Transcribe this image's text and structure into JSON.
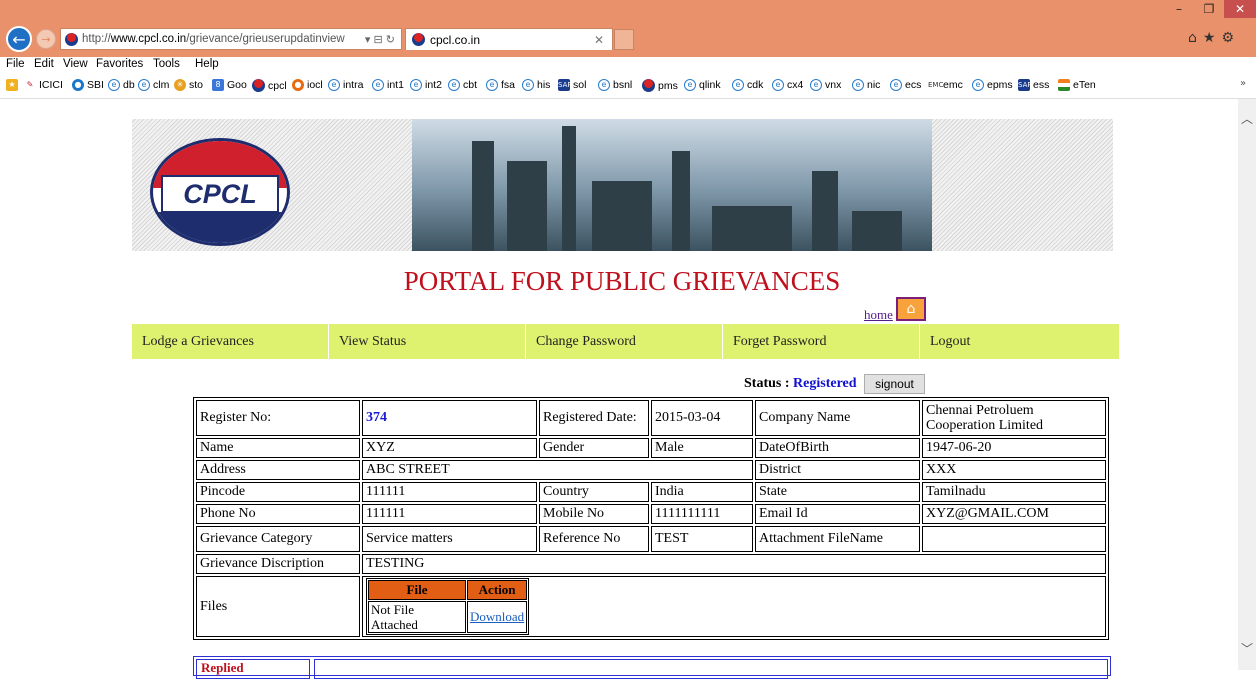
{
  "browser": {
    "url_prefix": "http://",
    "url_domain": "www.cpcl.co.in",
    "url_path": "/grievance/grieuserupdatinview",
    "tab_title": "cpcl.co.in",
    "menu": [
      "File",
      "Edit",
      "View",
      "Favorites",
      "Tools",
      "Help"
    ],
    "favorites": [
      "ICICI",
      "SBI",
      "db",
      "clm",
      "sto",
      "Goo",
      "cpcl",
      "iocl",
      "intra",
      "int1",
      "int2",
      "cbt",
      "fsa",
      "his",
      "sol",
      "bsnl",
      "pms",
      "qlink",
      "cdk",
      "cx4",
      "vnx",
      "nic",
      "ecs",
      "emc",
      "epms",
      "ess",
      "eTen"
    ]
  },
  "page": {
    "logo_text": "CPCL",
    "title": "PORTAL FOR PUBLIC GRIEVANCES",
    "home_link": "home",
    "nav": [
      "Lodge a Grievances",
      "View Status",
      "Change Password",
      "Forget Password",
      "Logout"
    ],
    "status_label": "Status",
    "status_value": "Registered",
    "signout_label": "signout"
  },
  "record": {
    "register_no_label": "Register No:",
    "register_no": "374",
    "registered_date_label": "Registered Date:",
    "registered_date": "2015-03-04",
    "company_label": "Company Name",
    "company": "Chennai Petroluem Cooperation Limited",
    "name_label": "Name",
    "name": "XYZ",
    "gender_label": "Gender",
    "gender": "Male",
    "dob_label": "DateOfBirth",
    "dob": "1947-06-20",
    "address_label": "Address",
    "address": "ABC STREET",
    "district_label": "District",
    "district": "XXX",
    "pincode_label": "Pincode",
    "pincode": "111111",
    "country_label": "Country",
    "country": "India",
    "state_label": "State",
    "state": "Tamilnadu",
    "phone_label": "Phone No",
    "phone": "111111",
    "mobile_label": "Mobile No",
    "mobile": "1111111111",
    "email_label": "Email Id",
    "email": "XYZ@GMAIL.COM",
    "category_label": "Grievance Category",
    "category": "Service matters",
    "reference_label": "Reference No",
    "reference": "TEST",
    "attachment_label": "Attachment FileName",
    "attachment": "",
    "description_label": "Grievance Discription",
    "description": "TESTING",
    "files_label": "Files",
    "files_col_file": "File",
    "files_col_action": "Action",
    "files_file": "Not File Attached",
    "files_action": "Download"
  },
  "replied_label": "Replied"
}
